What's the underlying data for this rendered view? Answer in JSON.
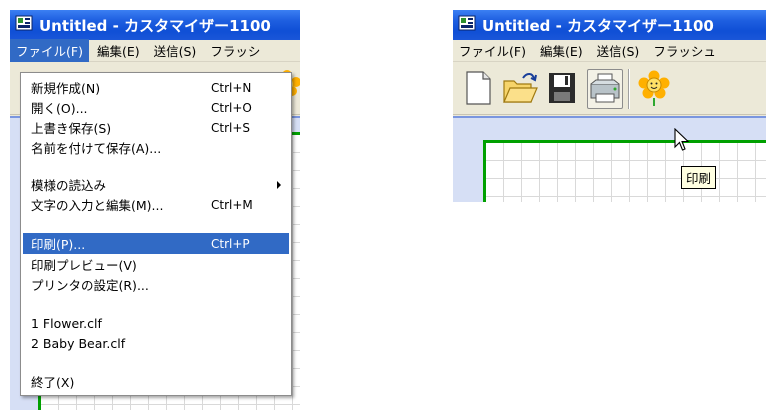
{
  "left_window": {
    "title": "Untitled - カスタマイザー1100",
    "menus": [
      "ファイル(F)",
      "編集(E)",
      "送信(S)",
      "フラッシ"
    ],
    "open_menu_index": 0
  },
  "file_menu": {
    "items": [
      {
        "label": "新規作成(N)",
        "shortcut": "Ctrl+N"
      },
      {
        "label": "開く(O)...",
        "shortcut": "Ctrl+O"
      },
      {
        "label": "上書き保存(S)",
        "shortcut": "Ctrl+S"
      },
      {
        "label": "名前を付けて保存(A)...",
        "shortcut": ""
      },
      {
        "label": "模様の読込み",
        "shortcut": ""
      },
      {
        "label": "文字の入力と編集(M)...",
        "shortcut": "Ctrl+M"
      },
      {
        "label": "印刷(P)...",
        "shortcut": "Ctrl+P"
      },
      {
        "label": "印刷プレビュー(V)",
        "shortcut": ""
      },
      {
        "label": "プリンタの設定(R)...",
        "shortcut": ""
      },
      {
        "label": "1 Flower.clf",
        "shortcut": ""
      },
      {
        "label": "2 Baby Bear.clf",
        "shortcut": ""
      },
      {
        "label": "終了(X)",
        "shortcut": ""
      }
    ],
    "highlighted_index": 6
  },
  "right_window": {
    "title": "Untitled - カスタマイザー1100",
    "menus": [
      "ファイル(F)",
      "編集(E)",
      "送信(S)",
      "フラッシュ"
    ],
    "toolbar_icons": [
      "new-document-icon",
      "open-folder-icon",
      "save-floppy-icon",
      "print-printer-icon",
      "flower-icon"
    ],
    "hovered_button": "print-printer-icon",
    "tooltip": "印刷"
  },
  "colors": {
    "titlebar": "#0f4fd6",
    "menu_highlight": "#316ac5",
    "workarea": "#d6dff5",
    "page_border": "#00a000",
    "tooltip_bg": "#ffffe1"
  }
}
